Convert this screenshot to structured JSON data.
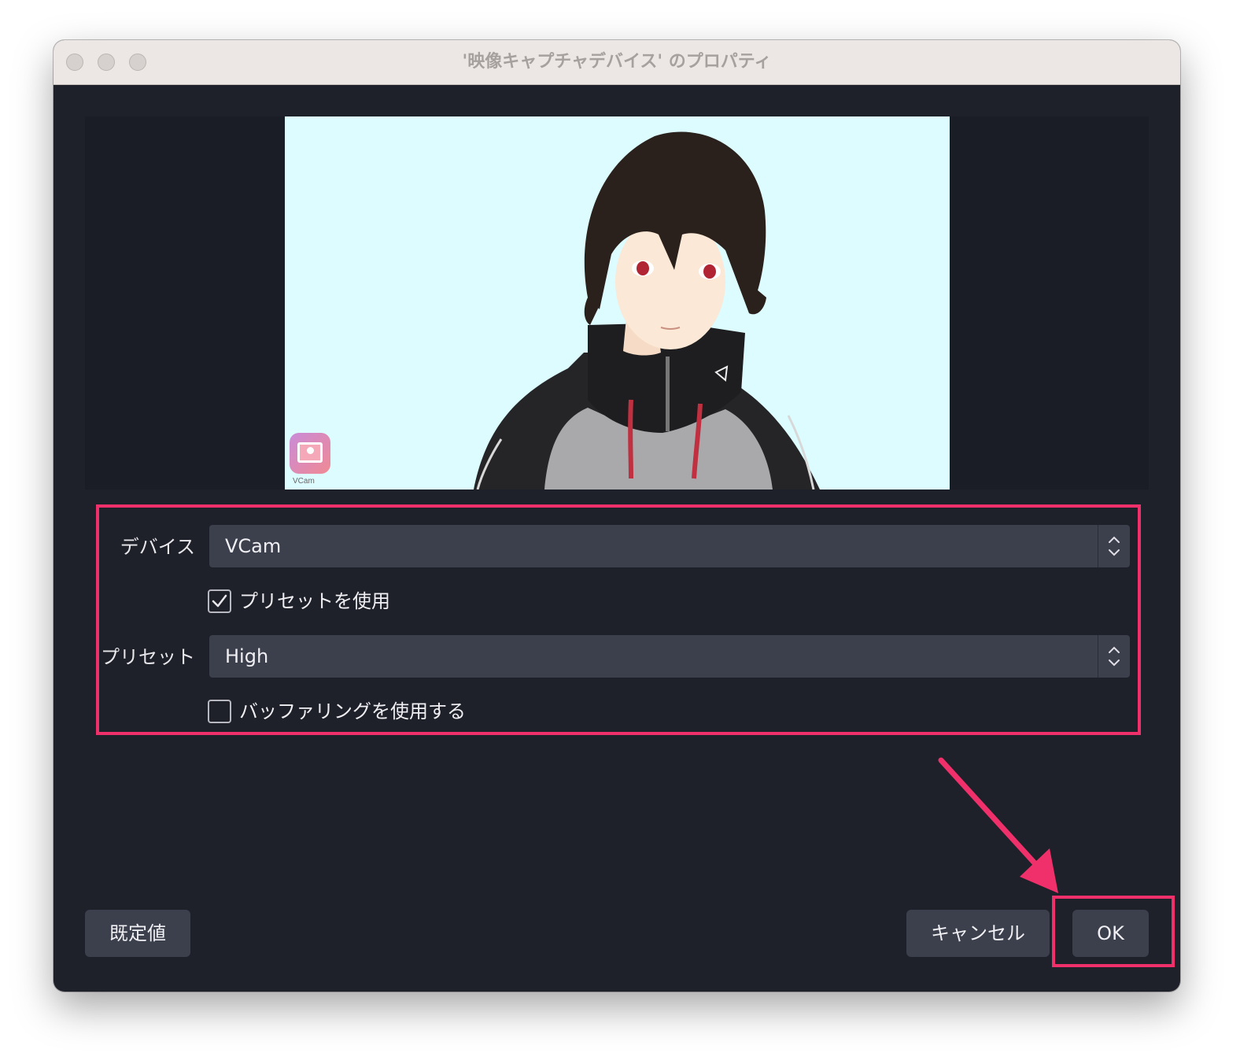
{
  "window": {
    "title": "'映像キャプチャデバイス' のプロパティ"
  },
  "preview": {
    "watermark_label": "VCam"
  },
  "form": {
    "device_label": "デバイス",
    "device_value": "VCam",
    "use_preset_label": "プリセットを使用",
    "use_preset_checked": true,
    "preset_label": "プリセット",
    "preset_value": "High",
    "use_buffering_label": "バッファリングを使用する",
    "use_buffering_checked": false
  },
  "buttons": {
    "defaults": "既定値",
    "cancel": "キャンセル",
    "ok": "OK"
  },
  "colors": {
    "highlight": "#f0306a",
    "window_bg": "#1f212a",
    "control_bg": "#3c3f4c"
  },
  "icons": {
    "traffic_close": "close-icon",
    "traffic_minimize": "minimize-icon",
    "traffic_maximize": "maximize-icon",
    "select_arrows": "updown-chevron-icon",
    "checkmark": "checkmark-icon",
    "vcam_logo": "vcam-logo-icon",
    "annotation_arrow": "arrow-icon"
  }
}
